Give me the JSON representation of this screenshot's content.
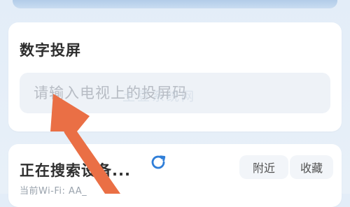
{
  "castCard": {
    "title": "数字投屏",
    "inputPlaceholder": "请输入电视上的投屏码"
  },
  "searchCard": {
    "title": "正在搜索设备...",
    "wifiLabel": "当前Wi-Fi: AA_",
    "tabs": [
      "附近",
      "收藏"
    ]
  },
  "watermark": "土豆系统网",
  "colors": {
    "accent": "#2f7ed8",
    "arrow": "#ea6f45"
  },
  "icons": [
    "refresh-icon",
    "arrow-annotation"
  ]
}
